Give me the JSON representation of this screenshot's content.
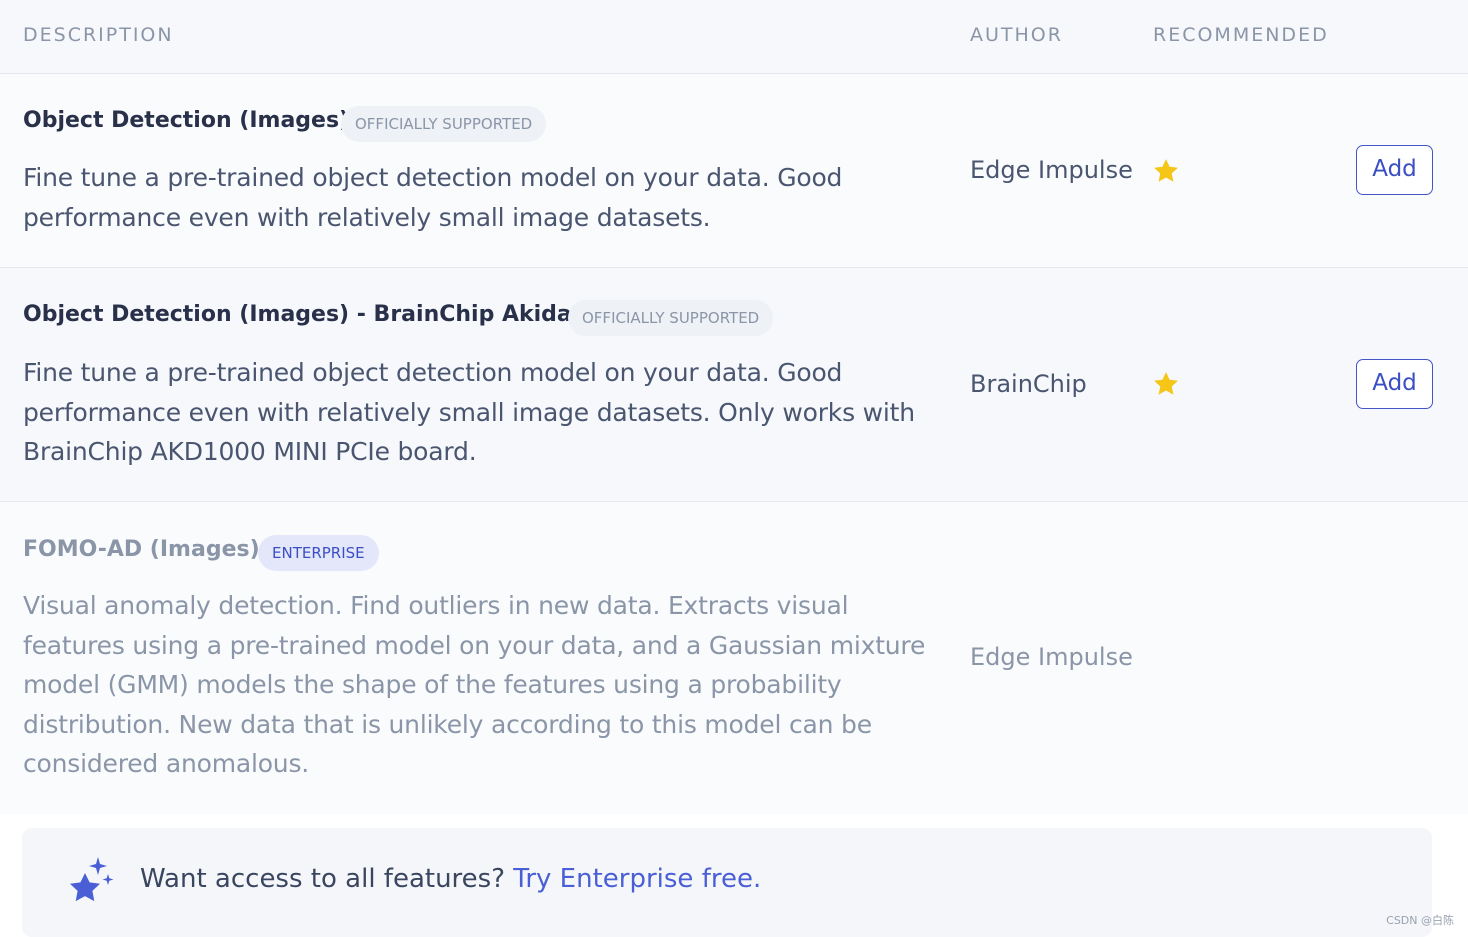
{
  "header": {
    "description": "DESCRIPTION",
    "author": "AUTHOR",
    "recommended": "RECOMMENDED"
  },
  "rows": [
    {
      "title": "Object Detection (Images)",
      "badge": "OFFICIALLY SUPPORTED",
      "description": "Fine tune a pre-trained object detection model on your data. Good performance even with relatively small image datasets.",
      "author": "Edge Impulse",
      "recommended": true,
      "action": "Add"
    },
    {
      "title": "Object Detection (Images) - BrainChip Akida™",
      "badge": "OFFICIALLY SUPPORTED",
      "description": "Fine tune a pre-trained object detection model on your data. Good performance even with relatively small image datasets. Only works with BrainChip AKD1000 MINI PCIe board.",
      "author": "BrainChip",
      "recommended": true,
      "action": "Add"
    },
    {
      "title": "FOMO-AD (Images)",
      "badge": "ENTERPRISE",
      "description": "Visual anomaly detection. Find outliers in new data. Extracts visual features using a pre-trained model on your data, and a Gaussian mixture model (GMM) models the shape of the features using a probability distribution. New data that is unlikely according to this model can be considered anomalous.",
      "author": "Edge Impulse",
      "recommended": false,
      "action": ""
    }
  ],
  "banner": {
    "text": "Want access to all features? ",
    "link": "Try Enterprise free."
  },
  "watermark": "CSDN @白陈",
  "colors": {
    "accent": "#3b4fc4",
    "star": "#f5c518",
    "icon": "#4a5fd6"
  }
}
